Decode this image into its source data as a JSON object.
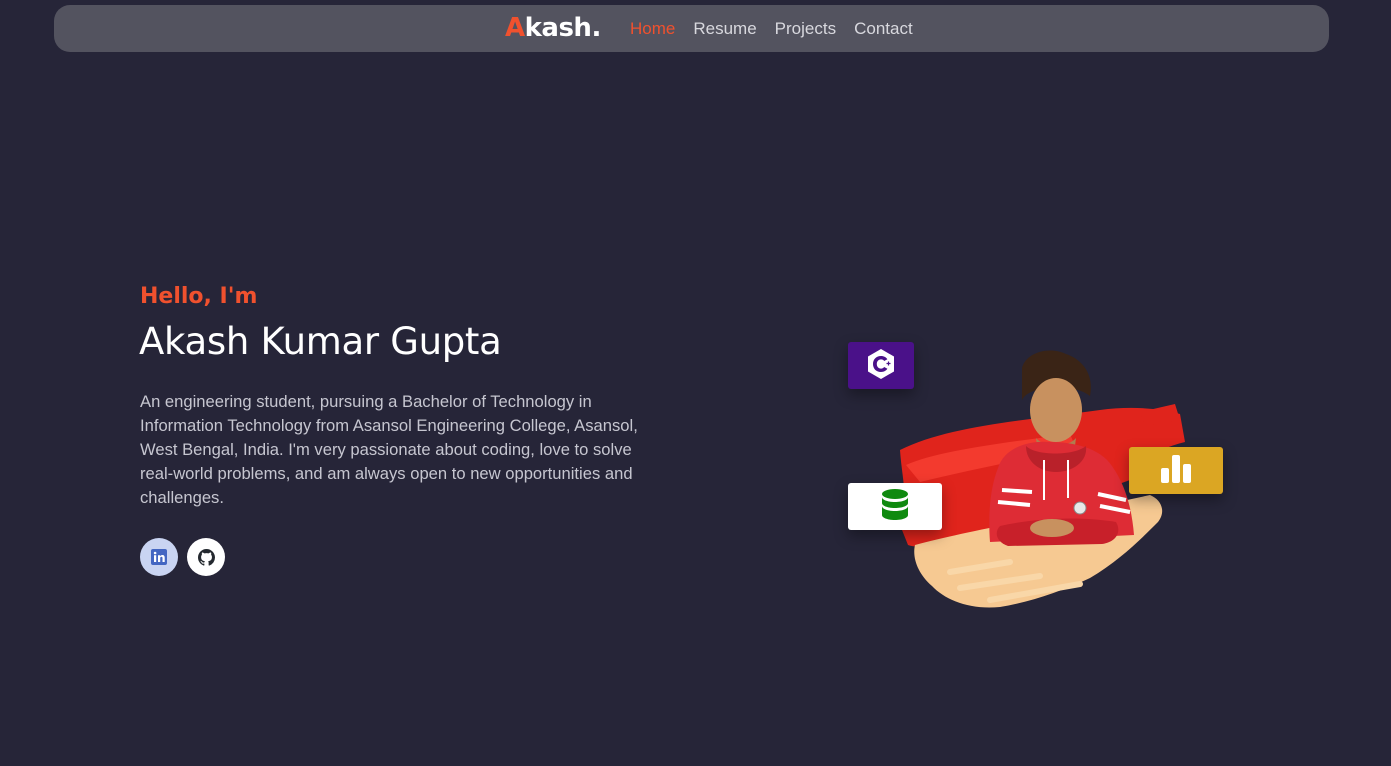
{
  "nav": {
    "logo_first": "A",
    "logo_rest": "kash.",
    "links": [
      {
        "label": "Home",
        "active": true
      },
      {
        "label": "Resume",
        "active": false
      },
      {
        "label": "Projects",
        "active": false
      },
      {
        "label": "Contact",
        "active": false
      }
    ]
  },
  "hero": {
    "greeting": "Hello, I'm",
    "name": "Akash Kumar Gupta",
    "bio": "An engineering student, pursuing a Bachelor of Technology in Information Technology from Asansol Engineering College, Asansol, West Bengal, India. I'm very passionate about coding, love to solve real-world problems, and am always open to new opportunities and challenges.",
    "socials": [
      {
        "icon": "linkedin-icon"
      },
      {
        "icon": "github-icon"
      }
    ]
  },
  "art": {
    "badges": [
      {
        "icon": "cpp-icon",
        "color": "#4a1189"
      },
      {
        "icon": "database-icon",
        "color": "#ffffff"
      },
      {
        "icon": "bar-chart-icon",
        "color": "#dba623"
      }
    ]
  },
  "colors": {
    "background": "#262538",
    "navbar": "#53535f",
    "accent": "#f0512e"
  }
}
